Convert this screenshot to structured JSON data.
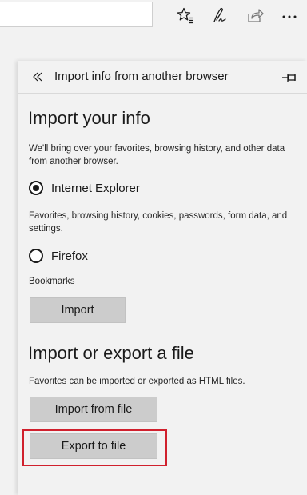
{
  "toolbar": {
    "address_value": "",
    "icons": [
      "favorites-star-icon",
      "notes-pen-icon",
      "share-icon",
      "more-icon"
    ]
  },
  "panel": {
    "title": "Import info from another browser",
    "import_heading": "Import your info",
    "import_description": "We'll bring over your favorites, browsing history, and other data from another browser.",
    "browsers": [
      {
        "label": "Internet Explorer",
        "checked": true,
        "details": "Favorites, browsing history, cookies, passwords, form data, and settings."
      },
      {
        "label": "Firefox",
        "checked": false,
        "details": "Bookmarks"
      }
    ],
    "import_button": "Import",
    "file_heading": "Import or export a file",
    "file_description": "Favorites can be imported or exported as HTML files.",
    "import_file_button": "Import from file",
    "export_file_button": "Export to file"
  },
  "colors": {
    "panel_bg": "#f2f2f2",
    "button_bg": "#cccccc",
    "highlight": "#d0202d"
  }
}
